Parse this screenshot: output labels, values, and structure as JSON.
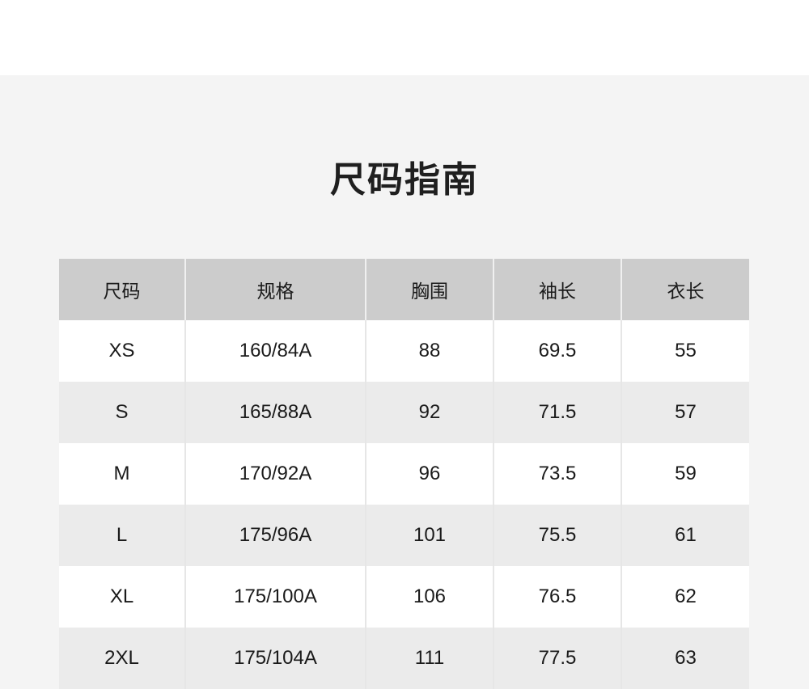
{
  "title": "尺码指南",
  "table": {
    "headers": [
      "尺码",
      "规格",
      "胸围",
      "袖长",
      "衣长"
    ],
    "rows": [
      [
        "XS",
        "160/84A",
        "88",
        "69.5",
        "55"
      ],
      [
        "S",
        "165/88A",
        "92",
        "71.5",
        "57"
      ],
      [
        "M",
        "170/92A",
        "96",
        "73.5",
        "59"
      ],
      [
        "L",
        "175/96A",
        "101",
        "75.5",
        "61"
      ],
      [
        "XL",
        "175/100A",
        "106",
        "76.5",
        "62"
      ],
      [
        "2XL",
        "175/104A",
        "111",
        "77.5",
        "63"
      ]
    ]
  }
}
